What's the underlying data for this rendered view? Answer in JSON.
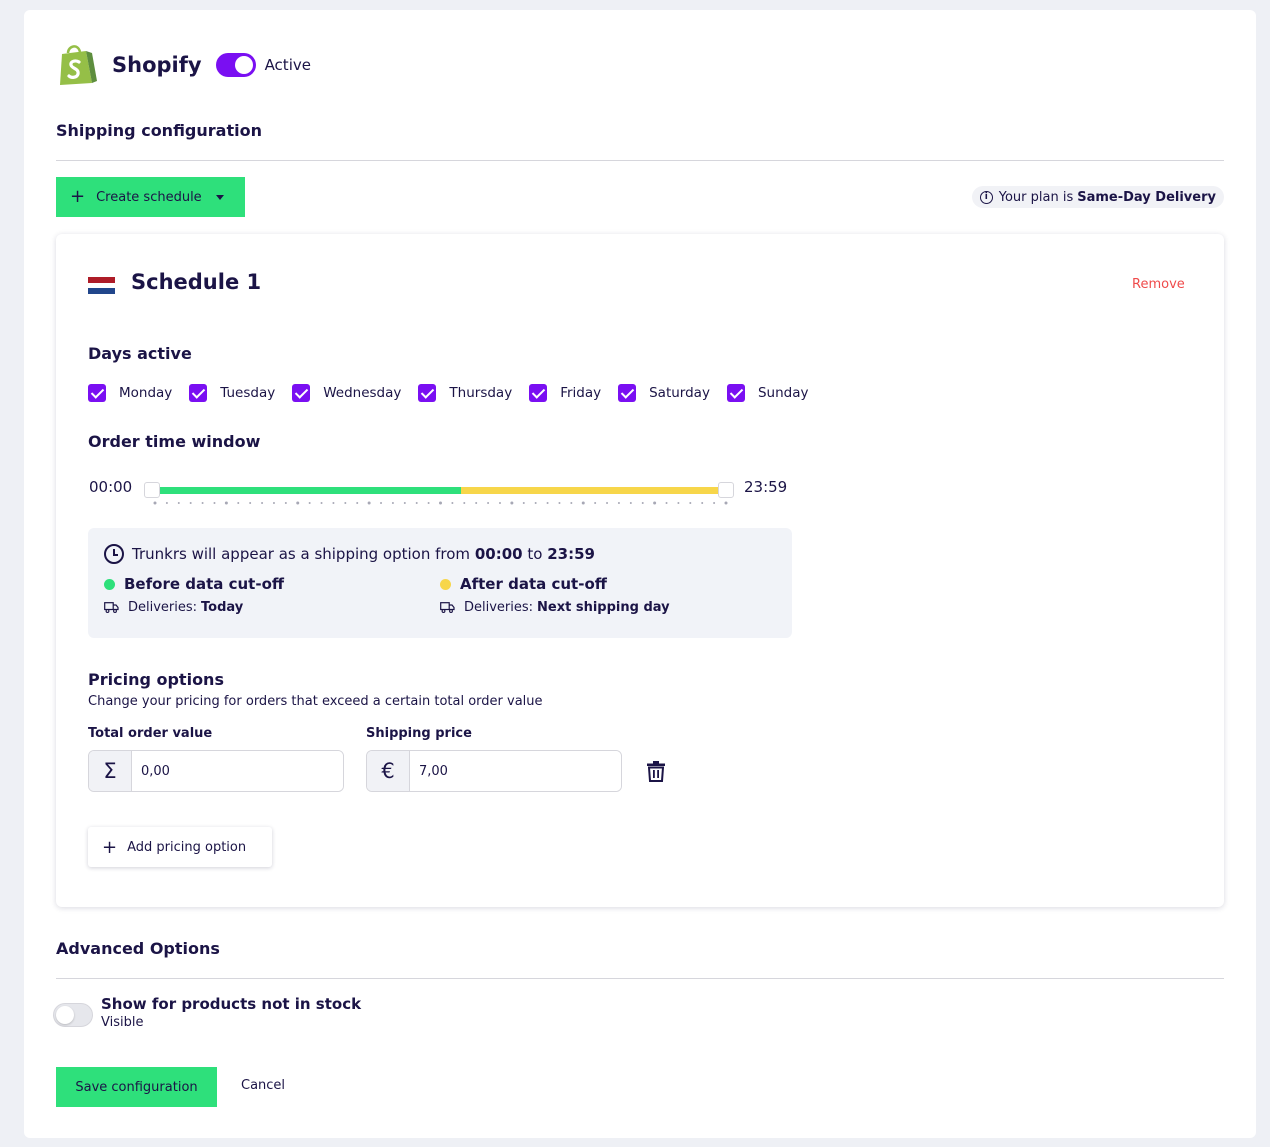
{
  "header": {
    "app_name": "Shopify",
    "logo_icon": "shopify-bag-icon",
    "status_label": "Active",
    "status_on": true
  },
  "shipping": {
    "title": "Shipping configuration",
    "create_button_label": "Create schedule",
    "plan_prefix": "Your plan is",
    "plan_name": "Same-Day Delivery"
  },
  "schedule": {
    "title": "Schedule 1",
    "flag": "netherlands-flag-icon",
    "remove_label": "Remove",
    "days_title": "Days active",
    "days": [
      {
        "label": "Monday",
        "checked": true
      },
      {
        "label": "Tuesday",
        "checked": true
      },
      {
        "label": "Wednesday",
        "checked": true
      },
      {
        "label": "Thursday",
        "checked": true
      },
      {
        "label": "Friday",
        "checked": true
      },
      {
        "label": "Saturday",
        "checked": true
      },
      {
        "label": "Sunday",
        "checked": true
      }
    ],
    "time_window_title": "Order time window",
    "start_time": "00:00",
    "end_time": "23:59",
    "cutoff_fraction": 0.54,
    "colors": {
      "before": "#2ee07b",
      "after": "#f7d64a"
    },
    "info": {
      "text": "Trunkrs will appear as a shipping option from",
      "from": "00:00",
      "to_word": "to",
      "to": "23:59",
      "before_title": "Before data cut-off",
      "before_label": "Deliveries:",
      "before_value": "Today",
      "after_title": "After data cut-off",
      "after_label": "Deliveries:",
      "after_value": "Next shipping day"
    },
    "pricing": {
      "title": "Pricing options",
      "description": "Change your pricing for orders that exceed a certain total order value",
      "total_label": "Total order value",
      "total_value": "0,00",
      "total_prefix": "Σ",
      "price_label": "Shipping price",
      "price_value": "7,00",
      "price_prefix": "€",
      "add_label": "Add pricing option"
    }
  },
  "advanced": {
    "title": "Advanced Options",
    "option_title": "Show for products not in stock",
    "option_sub": "Visible",
    "option_on": false
  },
  "footer": {
    "save_label": "Save configuration",
    "cancel_label": "Cancel"
  }
}
